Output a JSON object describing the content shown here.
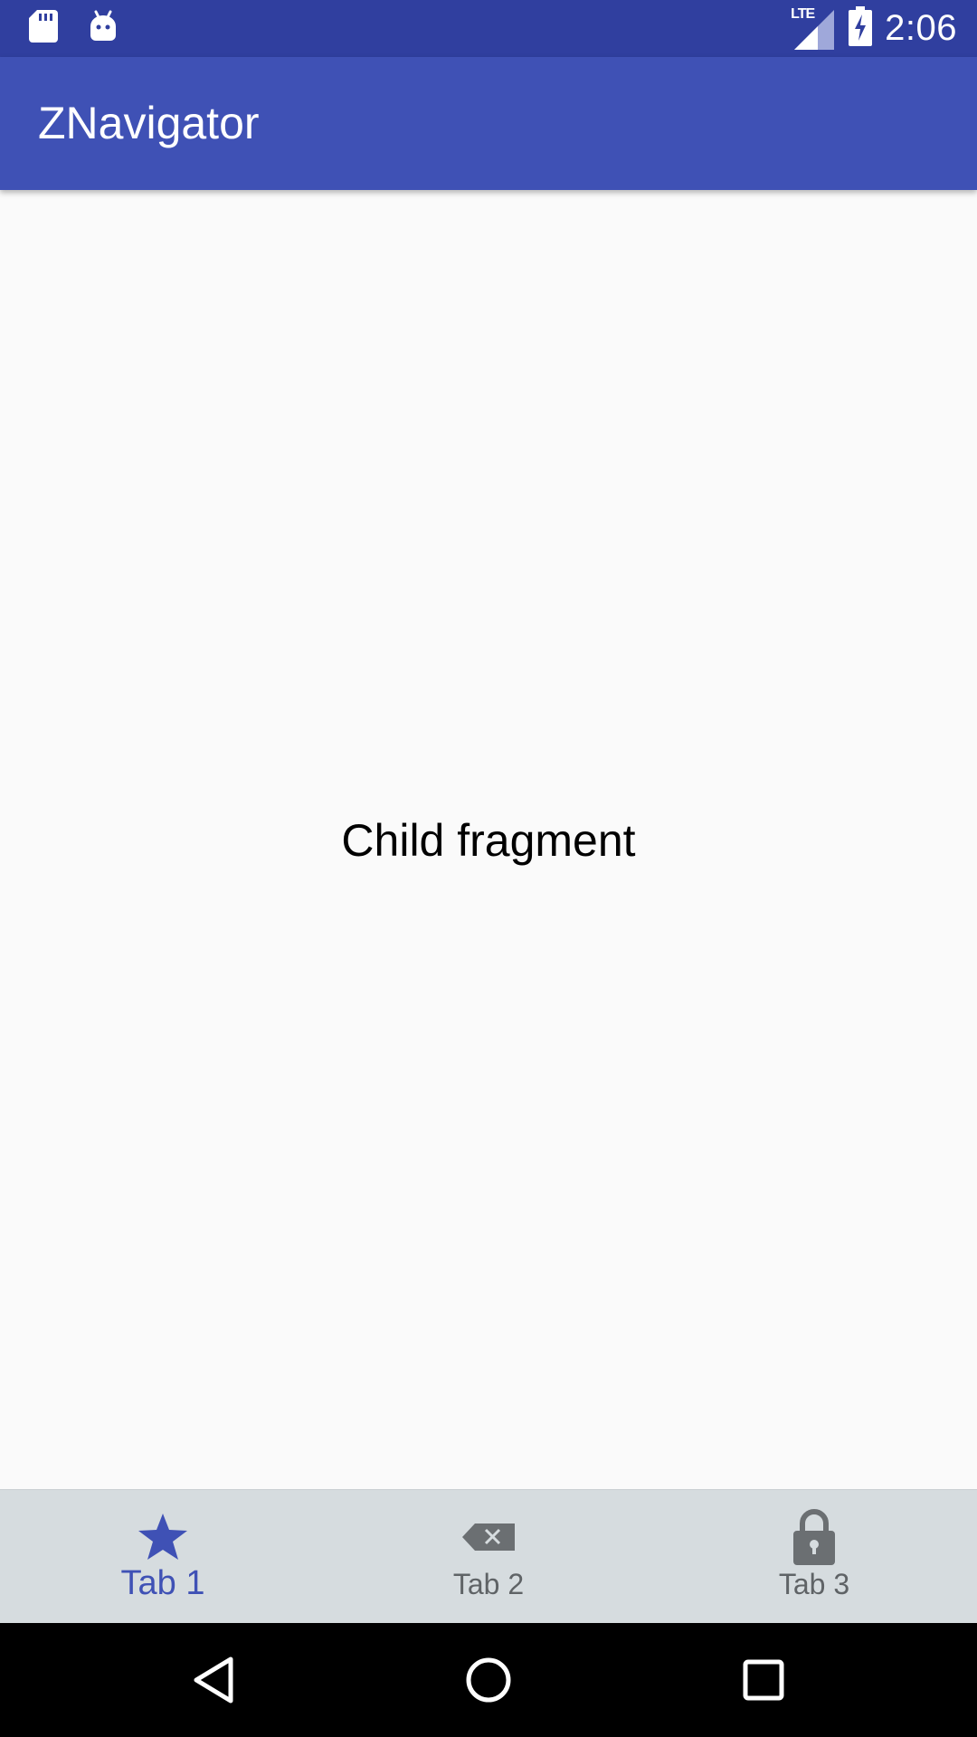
{
  "status_bar": {
    "time": "2:06",
    "network_label": "LTE",
    "background": "#303f9f",
    "icons": [
      "sd-card-icon",
      "android-debug-icon",
      "lte-signal-icon",
      "battery-charging-icon"
    ]
  },
  "app_bar": {
    "title": "ZNavigator",
    "background": "#3f51b5"
  },
  "content": {
    "text": "Child fragment"
  },
  "bottom_nav": {
    "background": "#d6dcdf",
    "active_color": "#3f51b5",
    "inactive_color": "#5f6366",
    "tabs": [
      {
        "label": "Tab 1",
        "icon": "star-icon",
        "active": true
      },
      {
        "label": "Tab 2",
        "icon": "backspace-icon",
        "active": false
      },
      {
        "label": "Tab 3",
        "icon": "lock-icon",
        "active": false
      }
    ]
  },
  "system_nav": {
    "buttons": [
      "back-icon",
      "home-icon",
      "recents-icon"
    ]
  }
}
